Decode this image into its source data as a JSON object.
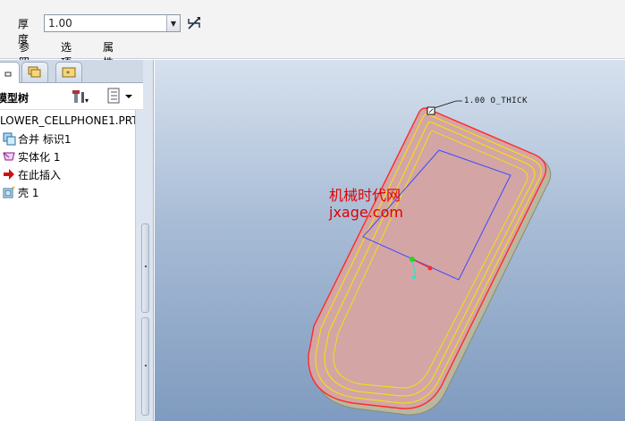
{
  "dashboard": {
    "thickness_label": "厚度",
    "thickness_value": "1.00",
    "tabs": [
      {
        "label": "参照"
      },
      {
        "label": "选项"
      },
      {
        "label": "属性"
      }
    ]
  },
  "navigator": {
    "title": "模型树",
    "tree": [
      {
        "label": "LOWER_CELLPHONE1.PRT",
        "icon": "part-icon"
      },
      {
        "label": "合并 标识1",
        "icon": "merge-feature-icon"
      },
      {
        "label": "实体化 1",
        "icon": "solidify-feature-icon"
      },
      {
        "label": "在此插入",
        "icon": "insert-here-arrow-icon"
      },
      {
        "label": "壳 1",
        "icon": "shell-feature-icon"
      }
    ]
  },
  "graphics": {
    "thickness_annotation": "1.00 O_THICK",
    "watermark_line1": "机械时代网",
    "watermark_line2": "jxage.com"
  },
  "colors": {
    "part_fill": "#d4a5a5",
    "edge_red": "#ff2a2a",
    "edge_yellow": "#f2e800",
    "datum_blue": "#3a4cff",
    "watermark": "#e10000"
  }
}
